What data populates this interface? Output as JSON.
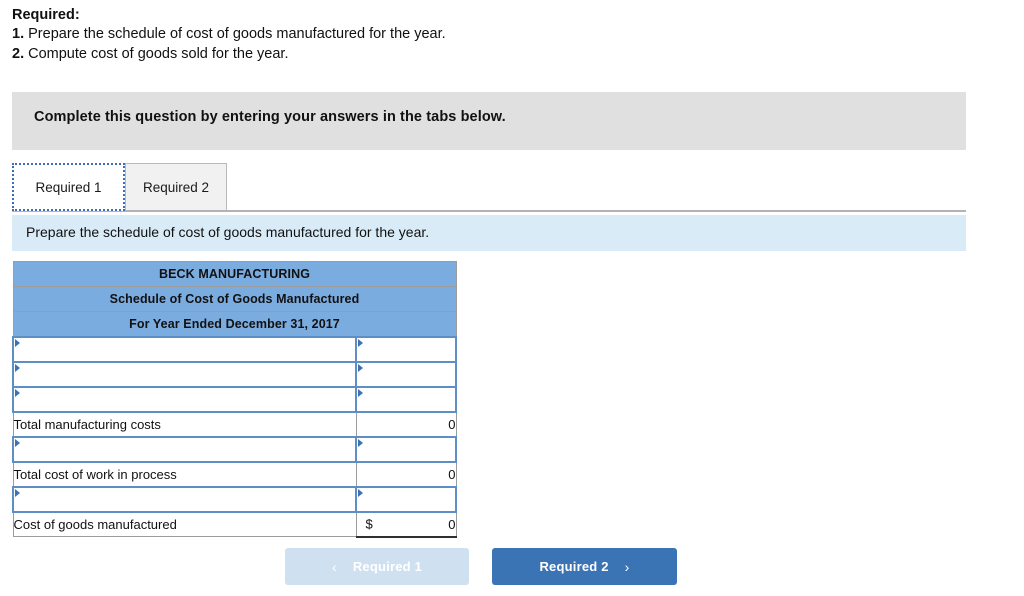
{
  "required": {
    "title": "Required:",
    "items": [
      {
        "num": "1.",
        "text": "Prepare the schedule of cost of goods manufactured for the year."
      },
      {
        "num": "2.",
        "text": "Compute cost of goods sold for the year."
      }
    ]
  },
  "banner": {
    "text": "Complete this question by entering your answers in the tabs below."
  },
  "tabs": [
    {
      "label": "Required 1",
      "active": true
    },
    {
      "label": "Required 2",
      "active": false
    }
  ],
  "sub_instruction": {
    "text": "Prepare the schedule of cost of goods manufactured for the year."
  },
  "schedule": {
    "header_rows": [
      "BECK MANUFACTURING",
      "Schedule of Cost of Goods Manufactured",
      "For Year Ended December 31, 2017"
    ],
    "rows": [
      {
        "type": "input",
        "label": "",
        "value": ""
      },
      {
        "type": "input",
        "label": "",
        "value": ""
      },
      {
        "type": "input",
        "label": "",
        "value": ""
      },
      {
        "type": "total",
        "label": "Total manufacturing costs",
        "value": "0"
      },
      {
        "type": "input",
        "label": "",
        "value": ""
      },
      {
        "type": "total",
        "label": "Total cost of work in process",
        "value": "0"
      },
      {
        "type": "input",
        "label": "",
        "value": ""
      },
      {
        "type": "grand",
        "label": "Cost of goods manufactured",
        "currency": "$",
        "value": "0"
      }
    ]
  },
  "nav": {
    "prev": {
      "label": "Required 1",
      "chevron": "‹",
      "disabled": true
    },
    "next": {
      "label": "Required 2",
      "chevron": "›",
      "disabled": false
    }
  },
  "colors": {
    "table_header": "#7bace0",
    "input_border": "#5d8fc6",
    "banner_gray": "#e0e0e0",
    "sub_blue": "#daebf8",
    "button_blue": "#3b74b4",
    "button_disabled": "#cfe0f0"
  }
}
